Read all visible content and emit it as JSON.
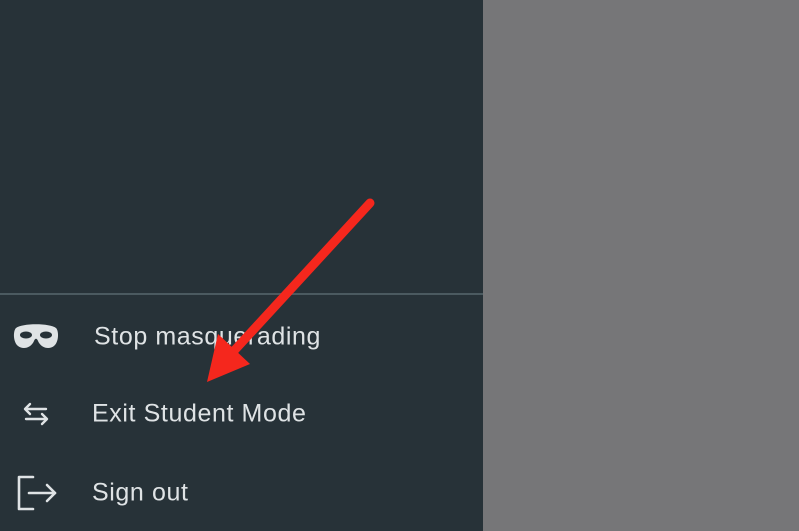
{
  "menu": {
    "items": [
      {
        "label": "Stop masquerading",
        "icon": "mask-icon"
      },
      {
        "label": "Exit Student Mode",
        "icon": "swap-arrows-icon"
      },
      {
        "label": "Sign out",
        "icon": "sign-out-icon"
      }
    ]
  },
  "colors": {
    "menu_background": "#273238",
    "page_overlay": "#767678",
    "label_text": "#dfe3e5",
    "annotation_arrow": "#f5271d"
  },
  "annotation": {
    "icon": "red-arrow"
  }
}
